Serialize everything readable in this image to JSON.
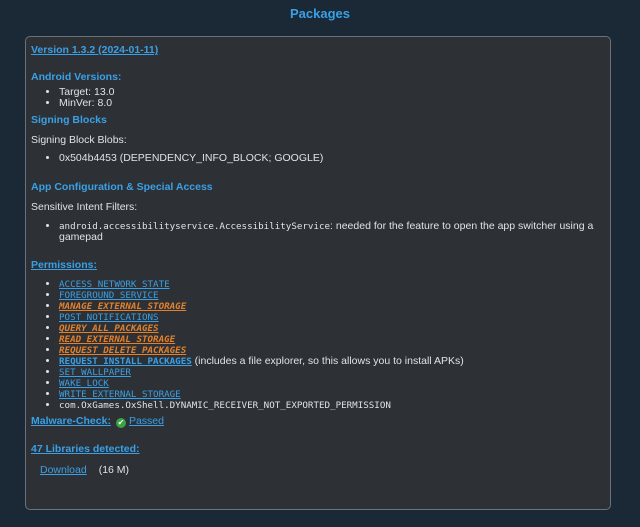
{
  "page_title": "Packages",
  "version_link": "Version 1.3.2 (2024-01-11)",
  "android_versions": {
    "heading": "Android Versions:",
    "items": [
      "Target: 13.0",
      "MinVer: 8.0"
    ]
  },
  "signing": {
    "heading": "Signing Blocks",
    "label": "Signing Block Blobs:",
    "items": [
      "0x504b4453 (DEPENDENCY_INFO_BLOCK; GOOGLE)"
    ]
  },
  "app_config": {
    "heading": "App Configuration & Special Access",
    "label": "Sensitive Intent Filters:",
    "service": "android.accessibilityservice.AccessibilityService",
    "service_desc": ": needed for the feature to open the app switcher using a gamepad"
  },
  "permissions": {
    "heading": "Permissions:",
    "items": [
      {
        "name": "ACCESS_NETWORK_STATE",
        "style": "link"
      },
      {
        "name": "FOREGROUND_SERVICE",
        "style": "link"
      },
      {
        "name": "MANAGE_EXTERNAL_STORAGE",
        "style": "danger"
      },
      {
        "name": "POST_NOTIFICATIONS",
        "style": "link"
      },
      {
        "name": "QUERY_ALL_PACKAGES",
        "style": "danger"
      },
      {
        "name": "READ_EXTERNAL_STORAGE",
        "style": "danger"
      },
      {
        "name": "REQUEST_DELETE_PACKAGES",
        "style": "danger"
      },
      {
        "name": "REQUEST_INSTALL_PACKAGES",
        "style": "link-bold",
        "note": " (includes a file explorer, so this allows you to install APKs)"
      },
      {
        "name": "SET_WALLPAPER",
        "style": "link"
      },
      {
        "name": "WAKE_LOCK",
        "style": "link"
      },
      {
        "name": "WRITE_EXTERNAL_STORAGE",
        "style": "link"
      },
      {
        "name": "com.OxGames.OxShell.DYNAMIC_RECEIVER_NOT_EXPORTED_PERMISSION",
        "style": "plain"
      }
    ]
  },
  "malware": {
    "heading": "Malware-Check:",
    "result": "Passed",
    "status_color": "#3aa343"
  },
  "libraries": {
    "heading": "47 Libraries detected:"
  },
  "download": {
    "label": "Download",
    "size": "(16 M)"
  },
  "colors": {
    "accent": "#3aa0e6",
    "danger": "#e3802b",
    "background": "#1b2936",
    "card": "#2d3136"
  }
}
